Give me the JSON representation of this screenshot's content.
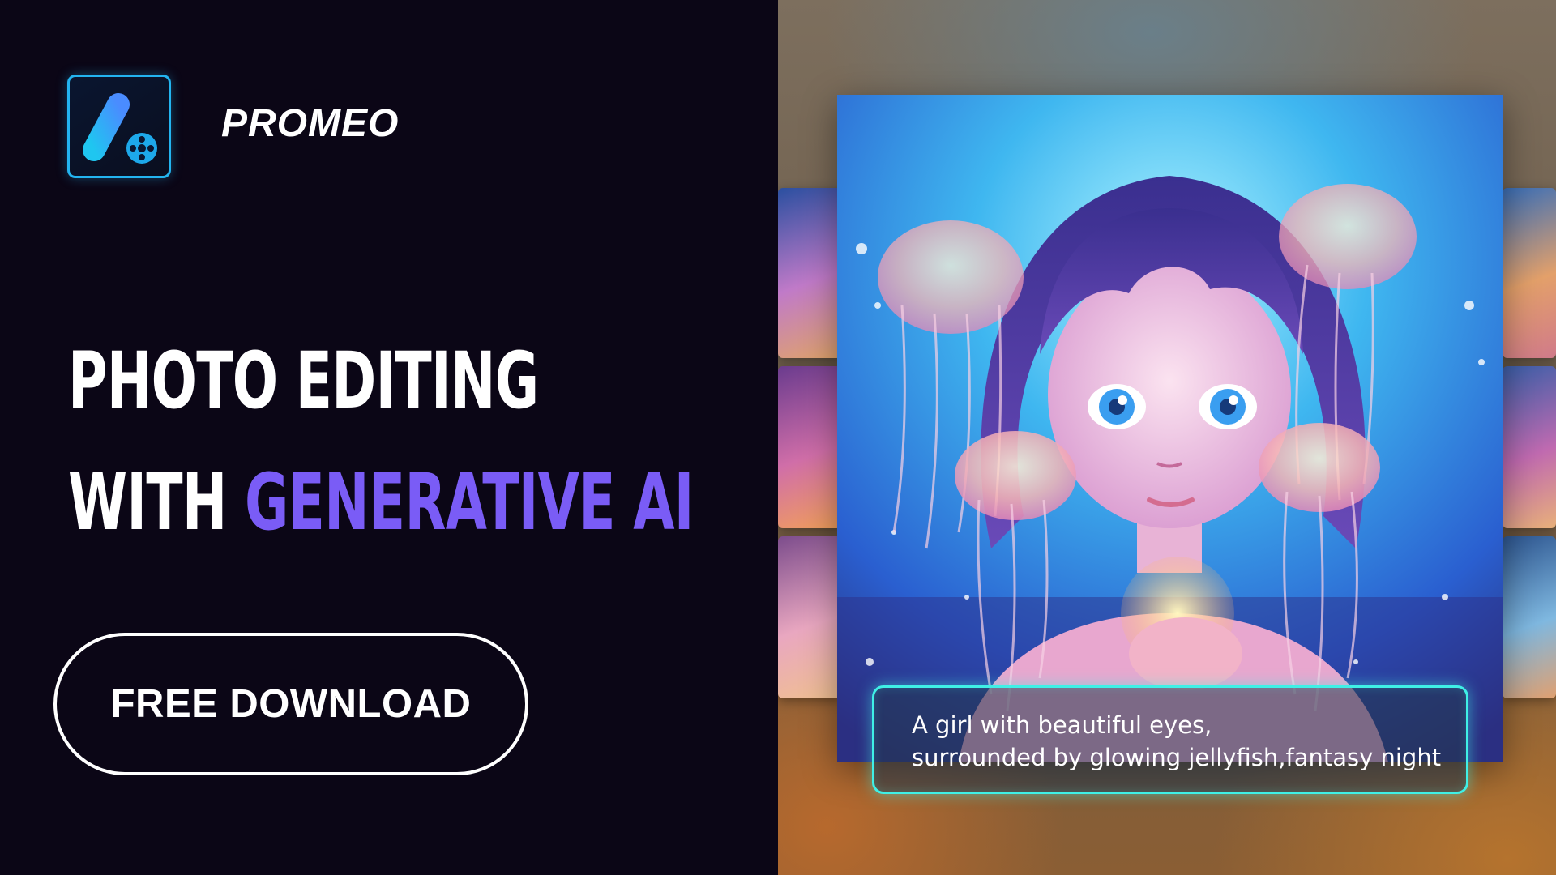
{
  "brand": {
    "name": "PROMEO"
  },
  "headline": {
    "line1": "PHOTO EDITING",
    "line2_prefix": "WITH ",
    "line2_accent": "GENERATIVE AI"
  },
  "cta": {
    "label": "FREE DOWNLOAD"
  },
  "prompt": {
    "line1": "A girl with beautiful eyes,",
    "line2": "surrounded by glowing jellyfish,fantasy night"
  },
  "colors": {
    "background": "#0b0616",
    "accent": "#7a5cf6",
    "logo_border": "#23b4f0",
    "prompt_border": "#3ff0e6"
  },
  "icons": [
    "promeo-logo-icon",
    "film-reel-icon"
  ]
}
